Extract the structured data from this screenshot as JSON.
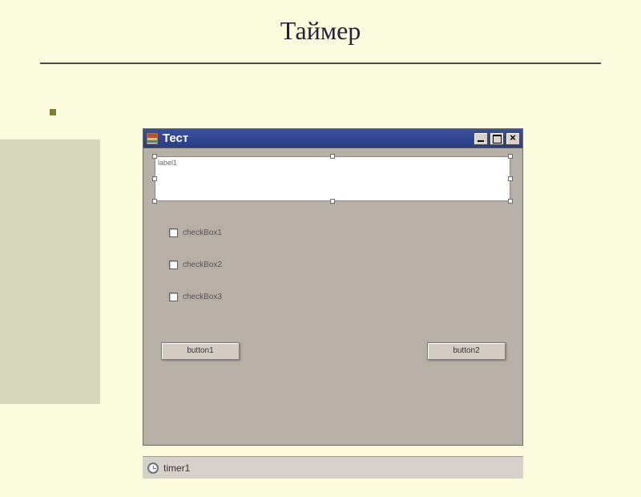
{
  "slide": {
    "title": "Таймер"
  },
  "window": {
    "title": "Тест",
    "label1": "label1",
    "checkboxes": [
      {
        "label": "checkBox1"
      },
      {
        "label": "checkBox2"
      },
      {
        "label": "checkBox3"
      }
    ],
    "buttons": {
      "button1": "button1",
      "button2": "button2"
    }
  },
  "tray": {
    "timer": "timer1"
  }
}
